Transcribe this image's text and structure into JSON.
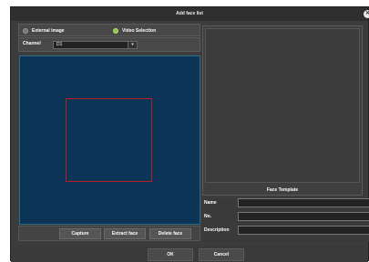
{
  "dialog": {
    "title": "Add face list",
    "close_icon": "close-icon"
  },
  "source": {
    "external_label": "External image",
    "video_label": "Video Selection",
    "selected": "video"
  },
  "channel": {
    "label": "Channel",
    "value": "D1"
  },
  "actions": {
    "capture": "Capture",
    "extract": "Extract face",
    "delete": "Delete face"
  },
  "template": {
    "label": "Face Template"
  },
  "info": {
    "name_label": "Name",
    "no_label": "No.",
    "description_label": "Description"
  },
  "footer": {
    "ok": "OK",
    "cancel": "Cancel"
  }
}
